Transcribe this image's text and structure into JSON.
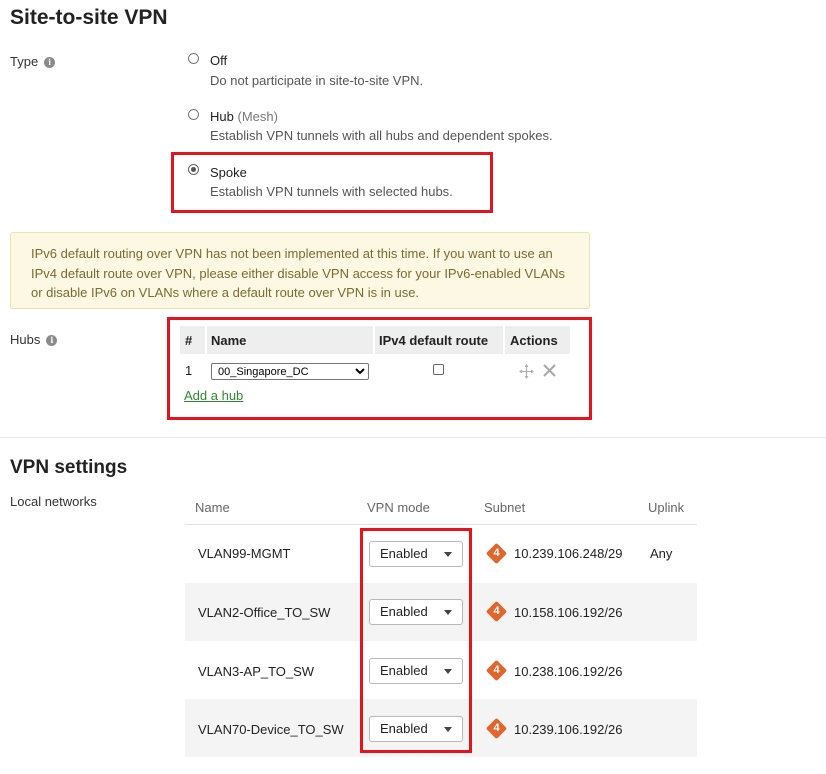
{
  "page_title": "Site-to-site VPN",
  "type_section": {
    "label": "Type",
    "options": [
      {
        "title": "Off",
        "title_suffix": "",
        "description": "Do not participate in site-to-site VPN.",
        "selected": false
      },
      {
        "title": "Hub",
        "title_suffix": "(Mesh)",
        "description": "Establish VPN tunnels with all hubs and dependent spokes.",
        "selected": false
      },
      {
        "title": "Spoke",
        "title_suffix": "",
        "description": "Establish VPN tunnels with selected hubs.",
        "selected": true
      }
    ]
  },
  "warning_text": "IPv6 default routing over VPN has not been implemented at this time. If you want to use an IPv4 default route over VPN, please either disable VPN access for your IPv6-enabled VLANs or disable IPv6 on VLANs where a default route over VPN is in use.",
  "hubs": {
    "label": "Hubs",
    "columns": [
      "#",
      "Name",
      "IPv4 default route",
      "Actions"
    ],
    "rows": [
      {
        "index": "1",
        "name": "00_Singapore_DC",
        "ipv4_default_route": false
      }
    ],
    "add_link": "Add a hub"
  },
  "vpn_settings": {
    "title": "VPN settings",
    "local_networks_label": "Local networks",
    "columns": [
      "Name",
      "VPN mode",
      "Subnet",
      "Uplink"
    ],
    "rows": [
      {
        "name": "VLAN99-MGMT",
        "vpn_mode": "Enabled",
        "ip_version": "4",
        "subnet": "10.239.106.248/29",
        "uplink": "Any"
      },
      {
        "name": "VLAN2-Office_TO_SW",
        "vpn_mode": "Enabled",
        "ip_version": "4",
        "subnet": "10.158.106.192/26",
        "uplink": ""
      },
      {
        "name": "VLAN3-AP_TO_SW",
        "vpn_mode": "Enabled",
        "ip_version": "4",
        "subnet": "10.238.106.192/26",
        "uplink": ""
      },
      {
        "name": "VLAN70-Device_TO_SW",
        "vpn_mode": "Enabled",
        "ip_version": "4",
        "subnet": "10.239.106.192/26",
        "uplink": ""
      }
    ]
  },
  "colors": {
    "highlight_red": "#e3141d",
    "link_green": "#2f8a2f",
    "ipv4_badge_orange": "#e0662c",
    "warning_bg": "#fdf8e3"
  },
  "icons": {
    "info": "info-icon",
    "move": "move-icon",
    "delete": "close-icon",
    "dropdown": "chevron-down-icon",
    "ip_version": "ipv4-badge-icon"
  }
}
